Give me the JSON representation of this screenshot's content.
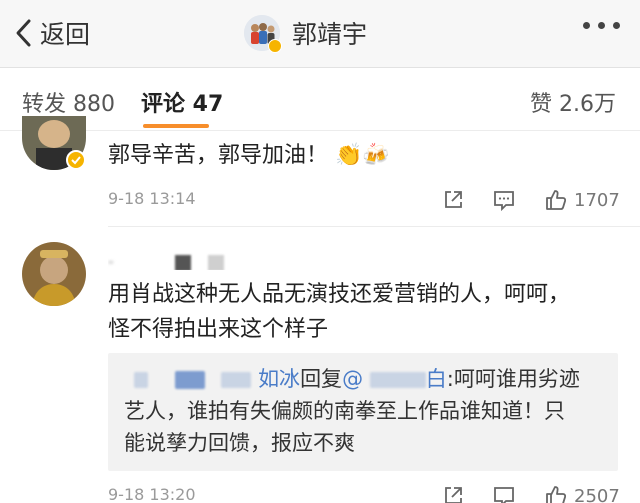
{
  "header": {
    "back_label": "返回",
    "title": "郭靖宇"
  },
  "tabs": {
    "repost": "转发 880",
    "comment": "评论 47",
    "like": "赞 2.6万"
  },
  "comments": [
    {
      "text": "郭导辛苦，郭导加油！",
      "time": "9-18 13:14",
      "likes": "1707"
    },
    {
      "username": "-",
      "text_line1": "用肖战这种无人品无演技还爱营销的人，呵呵，",
      "text_line2": "怪不得拍出来这个样子",
      "reply": {
        "name_tail": "如冰",
        "reply_word": "回复",
        "mention": "@",
        "target_tail": "白",
        "line1_rest": ":呵呵谁用劣迹",
        "line2": "艺人，谁拍有失偏颇的南拳至上作品谁知道！只",
        "line3": "能说孳力回馈，报应不爽"
      },
      "time": "9-18 13:20",
      "likes": "2507"
    }
  ],
  "colors": {
    "accent": "#f78e2b",
    "link": "#4a7cc8",
    "verified": "#f6b400"
  }
}
